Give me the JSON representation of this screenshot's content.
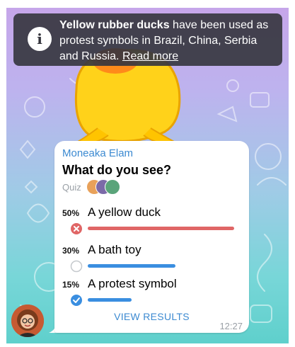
{
  "toast": {
    "icon": "info-icon",
    "bold_text": "Yellow rubber ducks",
    "text": " have been used as protest symbols in Brazil, China, Serbia and Russia. ",
    "link": "Read more"
  },
  "message": {
    "sender": "Moneaka Elam",
    "question": "What do you see?",
    "quiz_label": "Quiz",
    "options": [
      {
        "percent": "50%",
        "label": "A yellow duck",
        "fraction": 0.5,
        "state": "wrong",
        "bar_color": "#e06666"
      },
      {
        "percent": "30%",
        "label": "A bath toy",
        "fraction": 0.3,
        "state": "none",
        "bar_color": "#3a8ee0"
      },
      {
        "percent": "15%",
        "label": "A protest symbol",
        "fraction": 0.15,
        "state": "correct",
        "bar_color": "#3a8ee0"
      }
    ],
    "view_results": "VIEW RESULTS",
    "time": "12:27"
  },
  "colors": {
    "accent": "#3c8ad1",
    "wrong": "#e06666",
    "bar": "#3a8ee0",
    "toast_bg": "#37373f"
  }
}
